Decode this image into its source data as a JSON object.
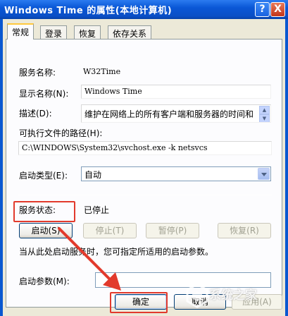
{
  "window": {
    "title": "Windows Time 的属性(本地计算机)",
    "help_label": "?",
    "close_label": "X"
  },
  "tabs": [
    {
      "label": "常规",
      "active": true
    },
    {
      "label": "登录",
      "active": false
    },
    {
      "label": "恢复",
      "active": false
    },
    {
      "label": "依存关系",
      "active": false
    }
  ],
  "general": {
    "service_name_label": "服务名称:",
    "service_name_value": "W32Time",
    "display_name_label": "显示名称(N):",
    "display_name_value": "Windows Time",
    "description_label": "描述(D):",
    "description_value": "维护在网络上的所有客户端和服务器的时间和",
    "exe_path_label": "可执行文件的路径(H):",
    "exe_path_value": "C:\\WINDOWS\\System32\\svchost.exe -k netsvcs",
    "startup_type_label": "启动类型(E):",
    "startup_type_value": "自动",
    "service_status_label": "服务状态:",
    "service_status_value": "已停止",
    "buttons": {
      "start": "启动(S)",
      "stop": "停止(T)",
      "pause": "暂停(P)",
      "resume": "恢复(R)"
    },
    "hint_text": "当从此处启动服务时，您可指定所适用的启动参数。",
    "start_params_label": "启动参数(M):",
    "start_params_value": ""
  },
  "footer": {
    "ok": "确定",
    "cancel": "取消",
    "apply": "应用(A)"
  },
  "watermark": {
    "text": "系统之家",
    "colors": {
      "annotation": "#e23a2c"
    }
  },
  "colors": {
    "titlebar": "#0a57d6",
    "dialog_bg": "#ece9d8",
    "highlight": "#e23a2c"
  }
}
